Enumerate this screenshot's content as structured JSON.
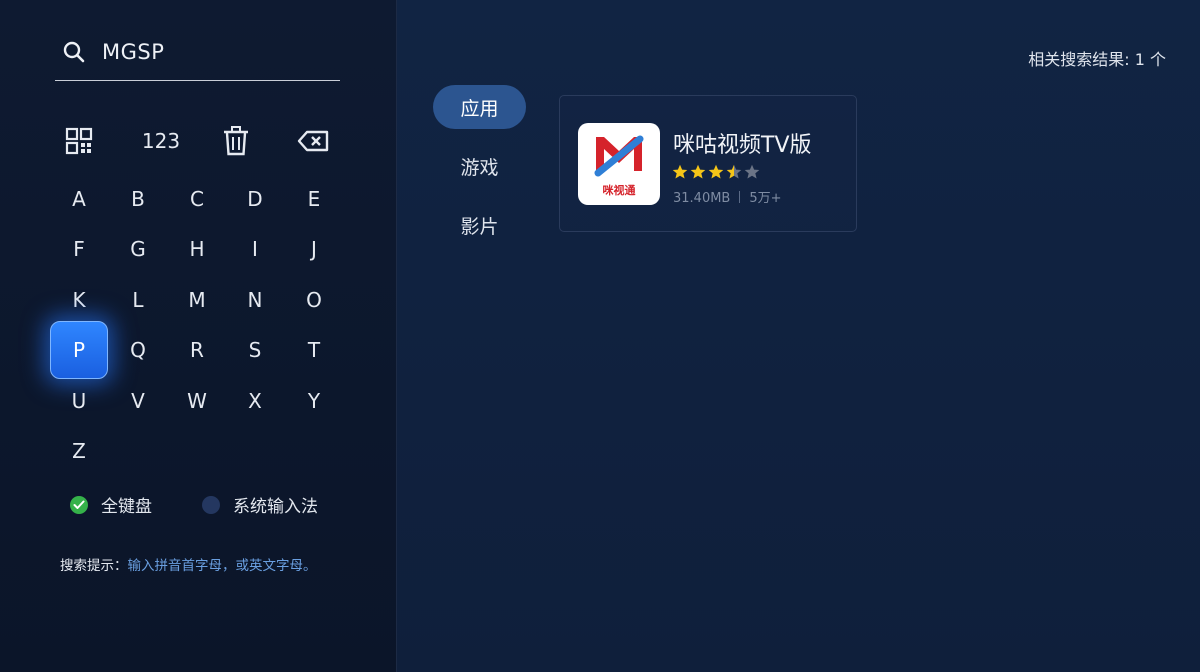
{
  "search": {
    "query": "MGSP"
  },
  "keypad": {
    "tools": {
      "numbers_label": "123"
    },
    "letters": [
      "A",
      "B",
      "C",
      "D",
      "E",
      "F",
      "G",
      "H",
      "I",
      "J",
      "K",
      "L",
      "M",
      "N",
      "O",
      "P",
      "Q",
      "R",
      "S",
      "T",
      "U",
      "V",
      "W",
      "X",
      "Y",
      "Z"
    ],
    "focused": "P"
  },
  "input_modes": [
    {
      "label": "全键盘",
      "selected": true
    },
    {
      "label": "系统输入法",
      "selected": false
    }
  ],
  "tip": {
    "label": "搜索提示：",
    "text": "输入拼音首字母，或英文字母。"
  },
  "results": {
    "count_text": "相关搜索结果: 1 个"
  },
  "tabs": [
    {
      "label": "应用",
      "active": true
    },
    {
      "label": "游戏",
      "active": false
    },
    {
      "label": "影片",
      "active": false
    }
  ],
  "app": {
    "name": "咪咕视频TV版",
    "icon_brand_text": "咪视通",
    "rating": 3.5,
    "rating_max": 5,
    "size": "31.40MB",
    "downloads": "5万+"
  },
  "colors": {
    "accent": "#2f86ff",
    "tab_active": "#2c5590",
    "star_on": "#f5c518",
    "star_off": "#6b7486",
    "check_on": "#35b24a"
  }
}
